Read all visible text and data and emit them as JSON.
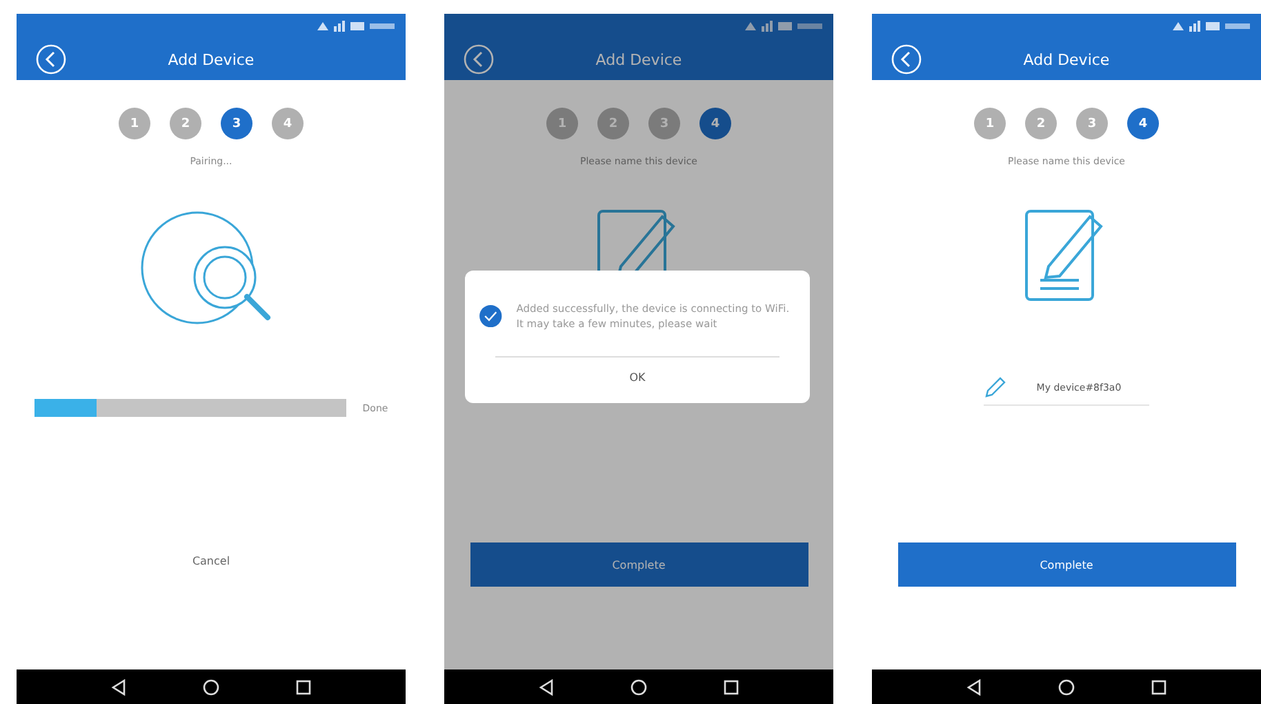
{
  "screens": [
    {
      "title": "Add Device",
      "steps": [
        {
          "label": "1",
          "selected": false
        },
        {
          "label": "2",
          "selected": false
        },
        {
          "label": "3",
          "selected": true
        },
        {
          "label": "4",
          "selected": false
        }
      ],
      "caption": "Pairing...",
      "kind": "pairing",
      "progress": {
        "level": 0.2,
        "label": "Done"
      },
      "button": {
        "label": "Cancel",
        "kind": "text"
      }
    },
    {
      "title": "Add Device",
      "steps": [
        {
          "label": "1",
          "selected": false
        },
        {
          "label": "2",
          "selected": false
        },
        {
          "label": "3",
          "selected": false
        },
        {
          "label": "4",
          "selected": true
        }
      ],
      "caption": "Please name this device",
      "kind": "naming",
      "button": {
        "label": "Complete",
        "kind": "primary"
      },
      "dialog": {
        "message": "Added successfully, the device is connecting to WiFi. It may take a few minutes, please wait",
        "button": "OK"
      }
    },
    {
      "title": "Add Device",
      "steps": [
        {
          "label": "1",
          "selected": false
        },
        {
          "label": "2",
          "selected": false
        },
        {
          "label": "3",
          "selected": false
        },
        {
          "label": "4",
          "selected": true
        }
      ],
      "caption": "Please name this device",
      "kind": "naming",
      "name_field": {
        "value": "My device#8f3a0"
      },
      "button": {
        "label": "Complete",
        "kind": "primary"
      }
    }
  ]
}
